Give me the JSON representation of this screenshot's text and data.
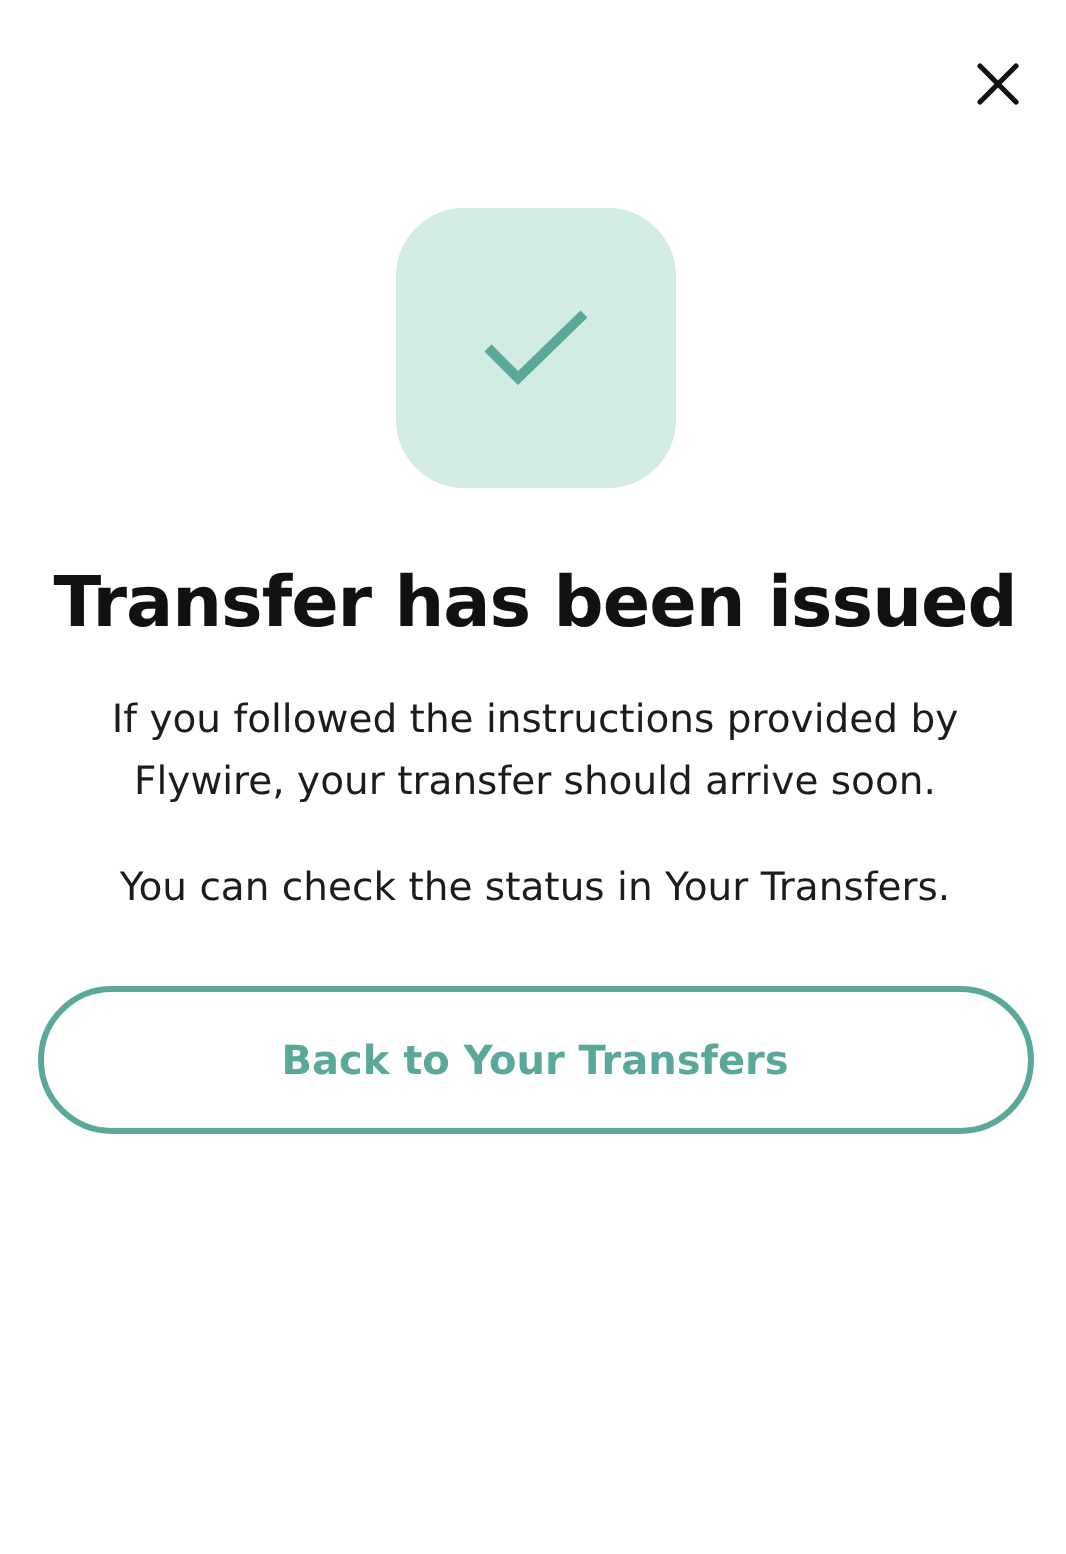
{
  "title": "Transfer has been issued",
  "messages": [
    "If you followed the instructions provided by Flywire, your transfer should arrive soon.",
    "You can check the status in Your Transfers."
  ],
  "button": {
    "label": "Back to Your Transfers"
  }
}
